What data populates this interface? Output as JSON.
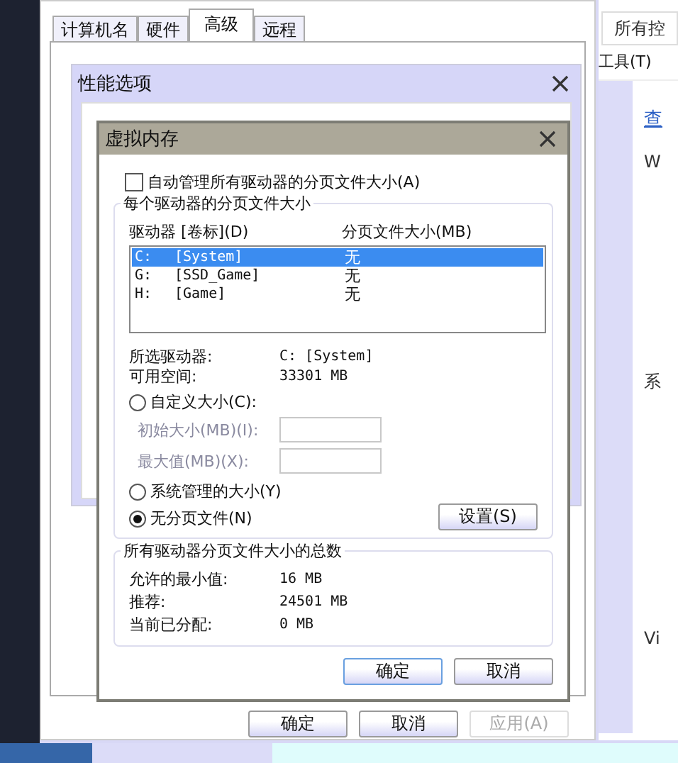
{
  "system_properties": {
    "tabs": [
      {
        "label": "计算机名",
        "selected": false
      },
      {
        "label": "硬件",
        "selected": false
      },
      {
        "label": "高级",
        "selected": true
      },
      {
        "label": "远程",
        "selected": false
      }
    ],
    "buttons": [
      {
        "label": "确定",
        "disabled": false
      },
      {
        "label": "取消",
        "disabled": false
      },
      {
        "label": "应用(A)",
        "disabled": true
      }
    ]
  },
  "performance_options": {
    "title": "性能选项"
  },
  "virtual_memory": {
    "title": "虚拟内存",
    "auto_manage": {
      "label": "自动管理所有驱动器的分页文件大小(A)",
      "checked": false
    },
    "per_drive": {
      "title": "每个驱动器的分页文件大小",
      "columns": [
        "驱动器 [卷标](D)",
        "分页文件大小(MB)"
      ],
      "drives": [
        {
          "drive": "C:",
          "volume": "[System]",
          "size": "无",
          "selected": true
        },
        {
          "drive": "G:",
          "volume": "[SSD_Game]",
          "size": "无",
          "selected": false
        },
        {
          "drive": "H:",
          "volume": "[Game]",
          "size": "无",
          "selected": false
        }
      ],
      "info": [
        {
          "label": "所选驱动器:",
          "value": "C:  [System]"
        },
        {
          "label": "可用空间:",
          "value": "33301 MB"
        }
      ],
      "options": [
        {
          "label": "自定义大小(C):",
          "selected": false
        },
        {
          "label": "系统管理的大小(Y)",
          "selected": false
        },
        {
          "label": "无分页文件(N)",
          "selected": true
        }
      ],
      "fields": [
        {
          "label": "初始大小(MB)(I):",
          "disabled": true
        },
        {
          "label": "最大值(MB)(X):",
          "disabled": true
        }
      ],
      "set_button": "设置(S)"
    },
    "totals": {
      "title": "所有驱动器分页文件大小的总数",
      "rows": [
        {
          "label": "允许的最小值:",
          "value": "16 MB"
        },
        {
          "label": "推荐:",
          "value": "24501 MB"
        },
        {
          "label": "当前已分配:",
          "value": "0 MB"
        }
      ]
    },
    "buttons": [
      "确定",
      "取消"
    ]
  },
  "control_panel": {
    "address": "所有控",
    "menu": "工具(T)",
    "link": "查",
    "texts": [
      "W",
      "系",
      "Vi"
    ]
  }
}
